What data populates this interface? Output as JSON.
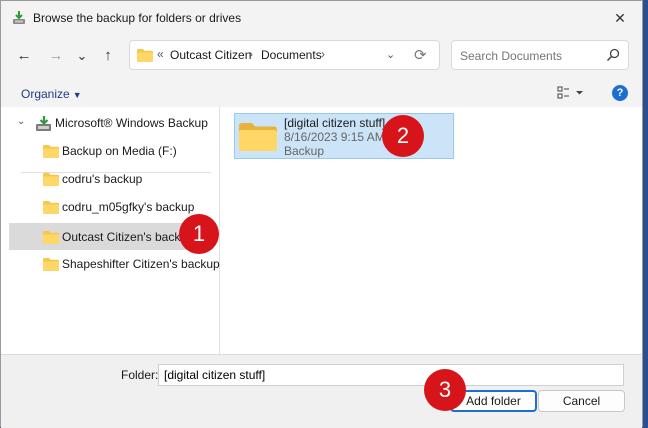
{
  "window": {
    "title": "Browse the backup for folders or drives",
    "close_glyph": "✕"
  },
  "nav": {
    "back_glyph": "←",
    "forward_glyph": "→",
    "recent_glyph": "⌄",
    "up_glyph": "↑"
  },
  "address": {
    "overflow": "«",
    "segments": [
      "Outcast Citizen",
      "Documents"
    ],
    "separator": "›",
    "dropdown_glyph": "⌄",
    "refresh_glyph": "⟳"
  },
  "search": {
    "placeholder": "Search Documents"
  },
  "command_bar": {
    "organize_label": "Organize",
    "organize_caret": "▼",
    "help_glyph": "?"
  },
  "tree": {
    "root": {
      "chevron": "⌄",
      "label": "Microsoft® Windows Backup"
    },
    "items": [
      {
        "label": "Backup on Media (F:)",
        "selected": false
      },
      {
        "label": "codru's backup",
        "selected": false
      },
      {
        "label": "codru_m05gfky's backup",
        "selected": false
      },
      {
        "label": "Outcast Citizen's backup",
        "selected": true
      },
      {
        "label": "Shapeshifter Citizen's backup",
        "selected": false
      }
    ]
  },
  "content": {
    "items": [
      {
        "name": "[digital citizen stuff]",
        "date": "8/16/2023 9:15 AM",
        "type": "Backup"
      }
    ]
  },
  "footer": {
    "folder_label": "Folder:",
    "folder_value": "[digital citizen stuff]",
    "add_button": "Add folder",
    "cancel_button": "Cancel"
  },
  "callouts": [
    "1",
    "2",
    "3"
  ],
  "colors": {
    "accent": "#1a6fd1",
    "selection": "#cce4f7",
    "callout": "#d8141b",
    "folder": "#f5c84c"
  }
}
